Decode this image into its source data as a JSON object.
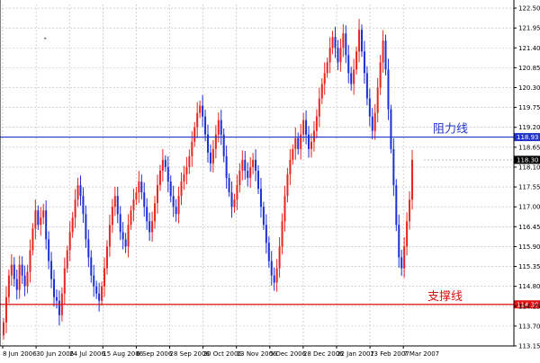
{
  "chart_data": {
    "type": "candlestick",
    "title": "",
    "xlabel": "",
    "ylabel": "",
    "ylim": [
      113.15,
      122.6
    ],
    "grid": true,
    "colors": {
      "up": "#e8251f",
      "down": "#1d2fd6",
      "resistance": "#2233cc",
      "support": "#dd1111",
      "axis": "#000000",
      "grid": "#b8b8b8"
    },
    "x_ticks": [
      "8 Jun 2006",
      "30 Jun 2006",
      "24 Jul 2006",
      "15 Aug 2006",
      "6 Sep 2006",
      "28 Sep 2006",
      "20 Oct 2006",
      "13 Nov 2006",
      "5 Dec 2006",
      "28 Dec 2006",
      "22 Jan 2007",
      "13 Feb 2007",
      "7 Mar 2007"
    ],
    "y_ticks": [
      122.5,
      121.95,
      121.4,
      120.85,
      120.3,
      119.75,
      119.2,
      118.65,
      118.1,
      117.55,
      117.0,
      116.45,
      115.9,
      115.35,
      114.8,
      114.25,
      113.7,
      113.15
    ],
    "closes": [
      113.8,
      114.5,
      115.1,
      115.4,
      115.0,
      114.7,
      115.4,
      115.1,
      114.8,
      115.2,
      115.8,
      116.4,
      116.9,
      116.5,
      116.7,
      116.9,
      116.1,
      115.5,
      115.0,
      114.5,
      114.4,
      114.0,
      114.6,
      115.3,
      115.8,
      116.3,
      116.7,
      117.2,
      117.6,
      117.3,
      116.8,
      116.1,
      115.6,
      115.1,
      114.8,
      114.6,
      114.4,
      114.8,
      115.3,
      115.9,
      116.5,
      117.0,
      117.3,
      116.8,
      116.3,
      116.1,
      115.9,
      116.5,
      116.9,
      117.2,
      117.4,
      117.7,
      117.4,
      117.0,
      116.6,
      116.3,
      116.6,
      117.1,
      117.6,
      118.0,
      118.3,
      118.1,
      117.7,
      117.3,
      117.0,
      116.8,
      117.3,
      117.7,
      117.9,
      118.1,
      118.4,
      118.8,
      119.2,
      119.6,
      119.8,
      119.5,
      119.0,
      118.5,
      118.2,
      118.6,
      119.0,
      119.4,
      119.0,
      118.4,
      117.8,
      117.4,
      117.0,
      117.2,
      117.6,
      118.0,
      118.3,
      118.0,
      117.8,
      118.1,
      118.3,
      118.0,
      117.5,
      117.0,
      116.5,
      116.0,
      115.5,
      115.1,
      114.9,
      115.3,
      115.9,
      116.6,
      117.3,
      117.9,
      118.3,
      118.6,
      118.9,
      118.6,
      119.0,
      119.4,
      119.0,
      118.6,
      118.8,
      119.1,
      119.5,
      120.0,
      120.4,
      120.7,
      121.0,
      121.4,
      121.7,
      121.4,
      121.0,
      121.4,
      121.8,
      121.2,
      120.7,
      120.4,
      120.8,
      121.3,
      121.9,
      121.3,
      120.7,
      120.0,
      119.5,
      119.1,
      119.6,
      120.3,
      121.0,
      121.6,
      120.8,
      119.7,
      118.6,
      117.6,
      116.5,
      115.6,
      115.3,
      115.9,
      116.6,
      117.2,
      118.3
    ],
    "lines": [
      {
        "name": "阻力线",
        "value": 118.93,
        "badge": "118.93"
      },
      {
        "name": "支撑线",
        "value": 114.3,
        "badge": "114.30"
      }
    ],
    "last_price": {
      "value": 118.3,
      "badge": "118.30"
    },
    "marker_glyph": "ˇ"
  }
}
